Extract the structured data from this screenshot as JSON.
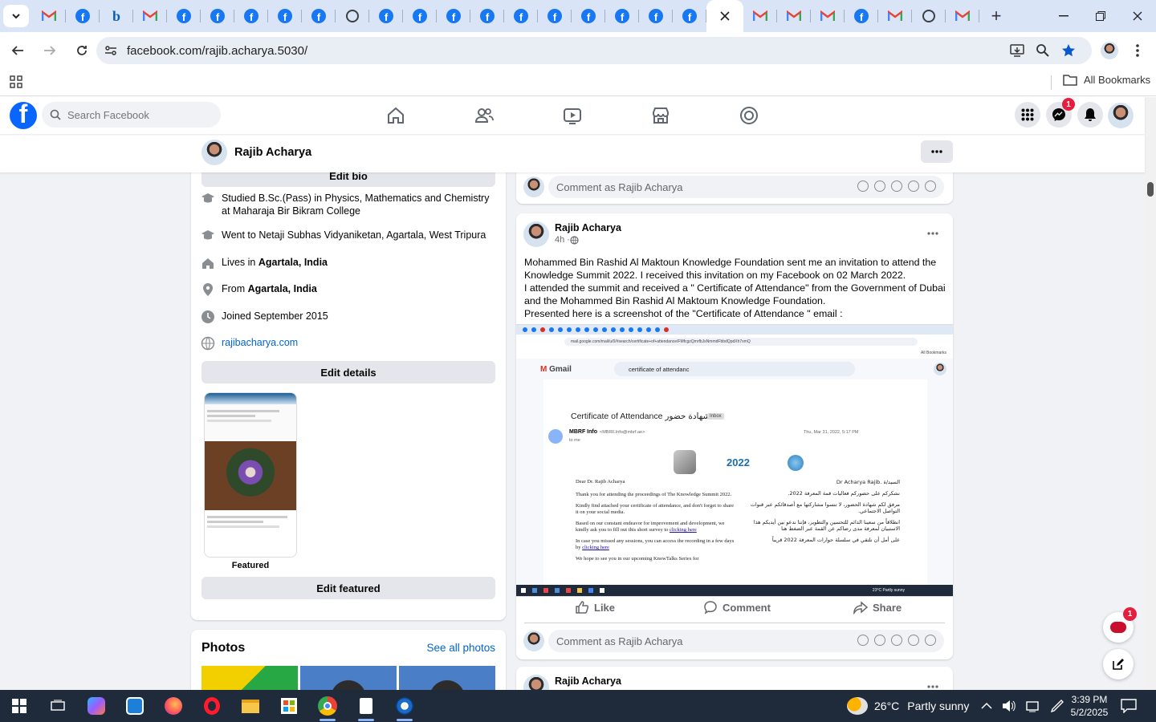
{
  "browser": {
    "tabs": [
      {
        "icon": "gmail-icon"
      },
      {
        "icon": "facebook-icon"
      },
      {
        "icon": "bing-icon"
      },
      {
        "icon": "gmail-icon"
      },
      {
        "icon": "facebook-icon"
      },
      {
        "icon": "facebook-icon"
      },
      {
        "icon": "facebook-icon"
      },
      {
        "icon": "facebook-icon"
      },
      {
        "icon": "facebook-icon"
      },
      {
        "icon": "globe-icon"
      },
      {
        "icon": "facebook-icon"
      },
      {
        "icon": "facebook-icon"
      },
      {
        "icon": "facebook-icon"
      },
      {
        "icon": "facebook-icon"
      },
      {
        "icon": "facebook-icon"
      },
      {
        "icon": "facebook-icon"
      },
      {
        "icon": "facebook-icon"
      },
      {
        "icon": "facebook-icon"
      },
      {
        "icon": "facebook-icon"
      },
      {
        "icon": "facebook-icon"
      },
      {
        "icon": "close-icon",
        "active": true
      },
      {
        "icon": "gmail-icon"
      },
      {
        "icon": "gmail-icon"
      },
      {
        "icon": "gmail-icon"
      },
      {
        "icon": "facebook-icon"
      },
      {
        "icon": "gmail-icon"
      },
      {
        "icon": "globe-icon"
      },
      {
        "icon": "gmail-icon"
      }
    ],
    "url": "facebook.com/rajib.acharya.5030/",
    "bookmarks_label": "All Bookmarks",
    "accent": "#d9e4f7"
  },
  "facebook": {
    "search_placeholder": "Search Facebook",
    "messenger_badge": "1",
    "brand_color": "#0866ff"
  },
  "profile": {
    "name": "Rajib Acharya",
    "edit_bio": "Edit bio",
    "intro": [
      {
        "icon": "graduation-cap-icon",
        "text": "Studied B.Sc.(Pass) in Physics, Mathematics and Chemistry at Maharaja Bir Bikram College"
      },
      {
        "icon": "graduation-cap-icon",
        "text": "Went to Netaji Subhas Vidyaniketan, Agartala, West Tripura"
      },
      {
        "icon": "home-icon",
        "prefix": "Lives in ",
        "bold": "Agartala, India"
      },
      {
        "icon": "location-pin-icon",
        "prefix": "From ",
        "bold": "Agartala, India"
      },
      {
        "icon": "clock-icon",
        "text": "Joined September 2015"
      },
      {
        "icon": "globe-icon",
        "link": "rajibacharya.com"
      }
    ],
    "edit_details": "Edit details",
    "featured_label": "Featured",
    "edit_featured": "Edit featured",
    "photos_title": "Photos",
    "see_all_photos": "See all photos"
  },
  "feed": {
    "comment_placeholder": "Comment as Rajib Acharya",
    "post": {
      "author": "Rajib Acharya",
      "time": "4h · ",
      "text": [
        "Mohammed Bin Rashid Al Maktoun Knowledge Foundation sent me an invitation to attend the Knowledge Summit 2022. I received this invitation on my Facebook on 02 March 2022.",
        "I attended the summit and received a \" Certificate of Attendance\" from the Government of Dubai and the   Mohammed Bin Rashid Al Maktoum Knowledge Foundation.",
        "Presented here is a screenshot of the \"Certificate of Attendance \" email :"
      ],
      "like": "Like",
      "comment": "Comment",
      "share": "Share"
    },
    "next_post_author": "Rajib Acharya",
    "email_shot": {
      "subject": "Certificate of Attendance شهادة حضور",
      "inbox_tag": "Inbox",
      "sender": "MBRF Info",
      "sender_email": "<MBRF.Info@mbrf.ae>",
      "to": "to me",
      "date": "Thu, Mar 31, 2022, 5:17 PM",
      "search_text": "certificate of attendanc",
      "gmail_label": "Gmail",
      "url": "mail.google.com/mail/u/0/#search/certificate+of+attendance/FMfcgzQmrfbJsNmmdFbbdQpdXh7xmQ",
      "all_bookmarks": "All Bookmarks",
      "year": "2022",
      "greeting_en": "Dear Dr. Rajib Acharya",
      "para1_en": "Thank you for attending the proceedings of The Knowledge Summit 2022.",
      "para2_en": "Kindly find attached your certificate of attendance, and don't forget to share it on your social media.",
      "para3_en": "Based on our constant endeavor for improvement and development, we kindly ask you to fill out this short survey to",
      "para3_link": "clicking here",
      "para4_en": "In case you missed any sessions, you can access the recording in a few days by",
      "para4_link": "clicking here",
      "para5_en": "We hope to see you in our upcoming KnowTalks Series for",
      "greeting_ar": "السيد/ة .Dr Acharya Rajib",
      "para1_ar": "نشكركم على حضوركم فعاليات قمة المعرفة 2022.",
      "para2_ar": "مرفق لكم شهادة الحضور، لا تنسوا مشاركتها مع أصدقائكم عبر قنوات التواصل الاجتماعي.",
      "para3_ar": "انطلاقاً من سعينا الدائم للتحسين والتطوير، فإننا ندعو بين أيديكم هذا الاستبيان لمعرفة مدى رضاكم عن القمة عبر الضغط هنا",
      "para4_ar": "على أمل أن نلتقي في سلسلة حوارات المعرفة 2022 قريباً",
      "weather": "23°C Partly sunny"
    }
  },
  "chat": {
    "badge": "1"
  },
  "taskbar": {
    "temperature": "26°C",
    "weather": "Partly sunny",
    "time": "3:39 PM",
    "date": "5/2/2025"
  }
}
